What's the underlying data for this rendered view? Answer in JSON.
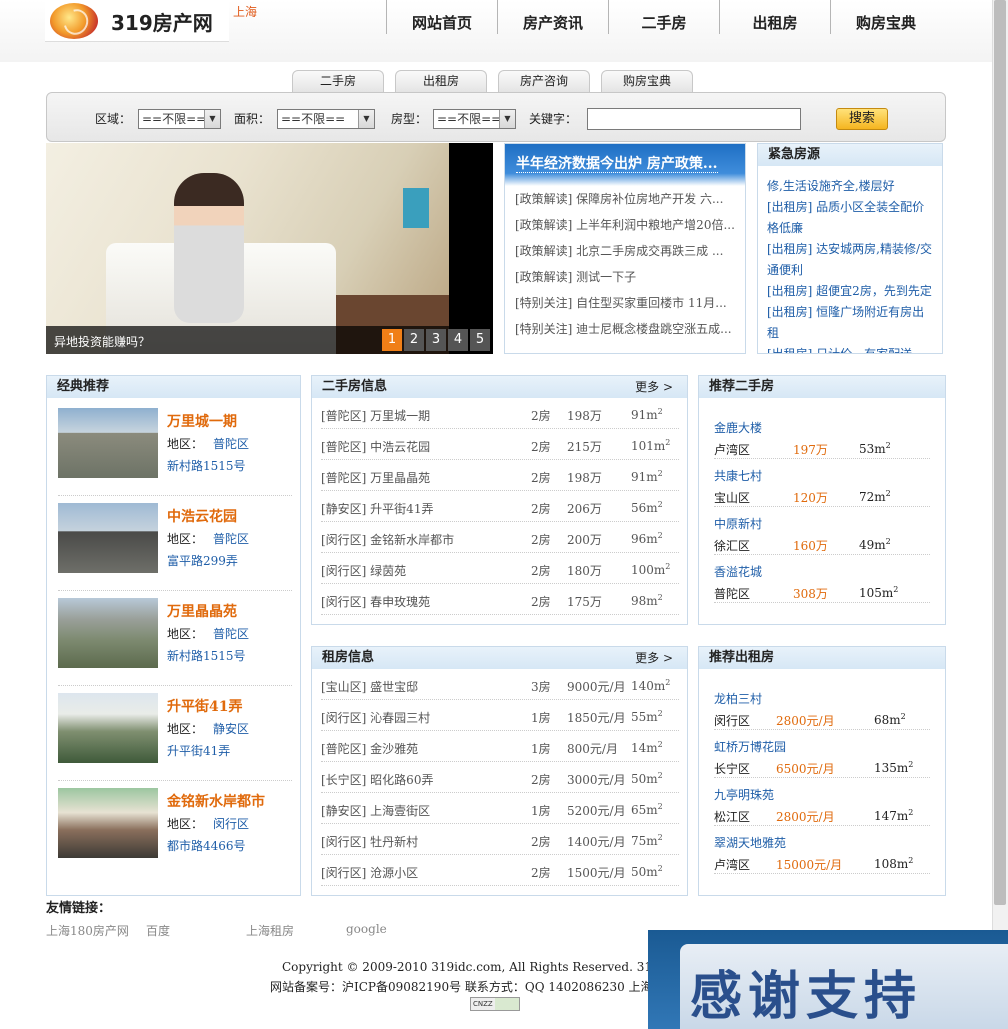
{
  "header": {
    "logo_text": "319房产网",
    "city": "上海",
    "nav": [
      "网站首页",
      "房产资讯",
      "二手房",
      "出租房",
      "购房宝典"
    ]
  },
  "search": {
    "tabs": [
      "二手房",
      "出租房",
      "房产咨询",
      "购房宝典"
    ],
    "labels": {
      "area": "区域：",
      "size": "面积：",
      "type": "房型：",
      "keyword": "关键字："
    },
    "select_value": "==不限==",
    "button": "搜索"
  },
  "hero": {
    "caption": "异地投资能赚吗？",
    "pages": [
      "1",
      "2",
      "3",
      "4",
      "5"
    ]
  },
  "news": {
    "headline": "半年经济数据今出炉 房产政策...",
    "items": [
      "[政策解读] 保障房补位房地产开发 六...",
      "[政策解读] 上半年利润中粮地产增20倍...",
      "[政策解读] 北京二手房成交再跌三成 ...",
      "[政策解读] 测试一下子",
      "[特别关注] 自住型买家重回楼市 11月...",
      "[特别关注] 迪士尼概念楼盘跳空涨五成..."
    ]
  },
  "urgent": {
    "title": "紧急房源",
    "items": [
      "修,生活设施齐全,楼层好",
      "[出租房] 品质小区全装全配价格低廉",
      "[出租房] 达安城两房,精装修/交通便利",
      "[出租房] 超便宜2房，先到先定",
      "[出租房] 恒隆广场附近有房出租",
      "[出租房] 日计价，有家配送"
    ]
  },
  "classic": {
    "title": "经典推荐",
    "area_label": "地区：",
    "items": [
      {
        "name": "万里城一期",
        "district": "普陀区",
        "address": "新村路1515号"
      },
      {
        "name": "中浩云花园",
        "district": "普陀区",
        "address": "富平路299弄"
      },
      {
        "name": "万里晶晶苑",
        "district": "普陀区",
        "address": "新村路1515号"
      },
      {
        "name": "升平街41弄",
        "district": "静安区",
        "address": "升平街41弄"
      },
      {
        "name": "金铭新水岸都市",
        "district": "闵行区",
        "address": "都市路4466号"
      }
    ]
  },
  "secondhand": {
    "title": "二手房信息",
    "more": "更多 >",
    "rows": [
      {
        "name": "[普陀区] 万里城一期",
        "rooms": "2房",
        "price": "198万",
        "size": "91m",
        "unit": "2"
      },
      {
        "name": "[普陀区] 中浩云花园",
        "rooms": "2房",
        "price": "215万",
        "size": "101m",
        "unit": "2"
      },
      {
        "name": "[普陀区] 万里晶晶苑",
        "rooms": "2房",
        "price": "198万",
        "size": "91m",
        "unit": "2"
      },
      {
        "name": "[静安区] 升平街41弄",
        "rooms": "2房",
        "price": "206万",
        "size": "56m",
        "unit": "2"
      },
      {
        "name": "[闵行区] 金铭新水岸都市",
        "rooms": "2房",
        "price": "200万",
        "size": "96m",
        "unit": "2"
      },
      {
        "name": "[闵行区] 绿茵苑",
        "rooms": "2房",
        "price": "180万",
        "size": "100m",
        "unit": "2"
      },
      {
        "name": "[闵行区] 春申玫瑰苑",
        "rooms": "2房",
        "price": "175万",
        "size": "98m",
        "unit": "2"
      }
    ]
  },
  "rental": {
    "title": "租房信息",
    "more": "更多 >",
    "rows": [
      {
        "name": "[宝山区] 盛世宝邸",
        "rooms": "3房",
        "price": "9000元/月",
        "size": "140m",
        "unit": "2"
      },
      {
        "name": "[闵行区] 沁春园三村",
        "rooms": "1房",
        "price": "1850元/月",
        "size": "55m",
        "unit": "2"
      },
      {
        "name": "[普陀区] 金沙雅苑",
        "rooms": "1房",
        "price": "800元/月",
        "size": "14m",
        "unit": "2"
      },
      {
        "name": "[长宁区] 昭化路60弄",
        "rooms": "2房",
        "price": "3000元/月",
        "size": "50m",
        "unit": "2"
      },
      {
        "name": "[静安区] 上海壹街区",
        "rooms": "1房",
        "price": "5200元/月",
        "size": "65m",
        "unit": "2"
      },
      {
        "name": "[闵行区] 牡丹新村",
        "rooms": "2房",
        "price": "1400元/月",
        "size": "75m",
        "unit": "2"
      },
      {
        "name": "[闵行区] 沧源小区",
        "rooms": "2房",
        "price": "1500元/月",
        "size": "50m",
        "unit": "2"
      }
    ]
  },
  "rec_secondhand": {
    "title": "推荐二手房",
    "items": [
      {
        "name": "金鹿大楼",
        "district": "卢湾区",
        "price": "197万",
        "size": "53m",
        "unit": "2"
      },
      {
        "name": "共康七村",
        "district": "宝山区",
        "price": "120万",
        "size": "72m",
        "unit": "2"
      },
      {
        "name": "中原新村",
        "district": "徐汇区",
        "price": "160万",
        "size": "49m",
        "unit": "2"
      },
      {
        "name": "香溢花城",
        "district": "普陀区",
        "price": "308万",
        "size": "105m",
        "unit": "2"
      }
    ]
  },
  "rec_rental": {
    "title": "推荐出租房",
    "items": [
      {
        "name": "龙柏三村",
        "district": "闵行区",
        "price": "2800元/月",
        "size": "68m",
        "unit": "2"
      },
      {
        "name": "虹桥万博花园",
        "district": "长宁区",
        "price": "6500元/月",
        "size": "135m",
        "unit": "2"
      },
      {
        "name": "九亭明珠苑",
        "district": "松江区",
        "price": "2800元/月",
        "size": "147m",
        "unit": "2"
      },
      {
        "name": "翠湖天地雅苑",
        "district": "卢湾区",
        "price": "15000元/月",
        "size": "108m",
        "unit": "2"
      }
    ]
  },
  "friends": {
    "title": "友情链接：",
    "links": [
      "上海180房产网",
      "百度",
      "上海租房",
      "google"
    ]
  },
  "footer": {
    "copyright": "Copyright © 2009-2010 319idc.com, All Rights Reserved. 319房产网 上海",
    "icp": "网站备案号：沪ICP备09082190号  联系方式：QQ 1402086230 上海180房",
    "cnzz": "CNZZ"
  },
  "overlay": {
    "text": "感谢支持"
  },
  "colors": {
    "accent": "#e06a0c",
    "link": "#1f5ea8",
    "active_dot": "#f07f17",
    "news_header": "#1f6fc4"
  }
}
